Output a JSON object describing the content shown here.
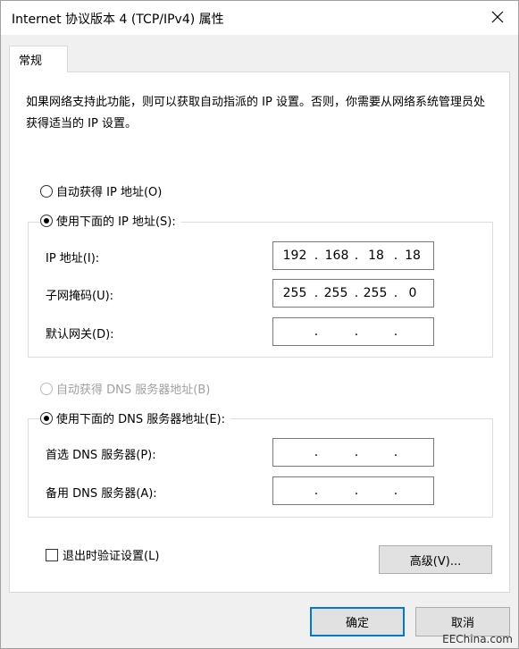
{
  "window": {
    "title": "Internet 协议版本 4 (TCP/IPv4) 属性"
  },
  "tab": {
    "label": "常规"
  },
  "description": "如果网络支持此功能，则可以获取自动指派的 IP 设置。否则，你需要从网络系统管理员处获得适当的 IP 设置。",
  "ip": {
    "auto_label": "自动获得 IP 地址(O)",
    "manual_label": "使用下面的 IP 地址(S):",
    "address_label": "IP 地址(I):",
    "address": [
      "192",
      "168",
      "18",
      "18"
    ],
    "mask_label": "子网掩码(U):",
    "mask": [
      "255",
      "255",
      "255",
      "0"
    ],
    "gateway_label": "默认网关(D):",
    "gateway": [
      "",
      "",
      "",
      ""
    ]
  },
  "dns": {
    "auto_label": "自动获得 DNS 服务器地址(B)",
    "manual_label": "使用下面的 DNS 服务器地址(E):",
    "preferred_label": "首选 DNS 服务器(P):",
    "preferred": [
      "",
      "",
      "",
      ""
    ],
    "alternate_label": "备用 DNS 服务器(A):",
    "alternate": [
      "",
      "",
      "",
      ""
    ]
  },
  "validate_label": "退出时验证设置(L)",
  "advanced_label": "高级(V)...",
  "ok_label": "确定",
  "cancel_label": "取消",
  "watermark": "EEChina.com",
  "icons": {
    "close": "close-icon"
  }
}
